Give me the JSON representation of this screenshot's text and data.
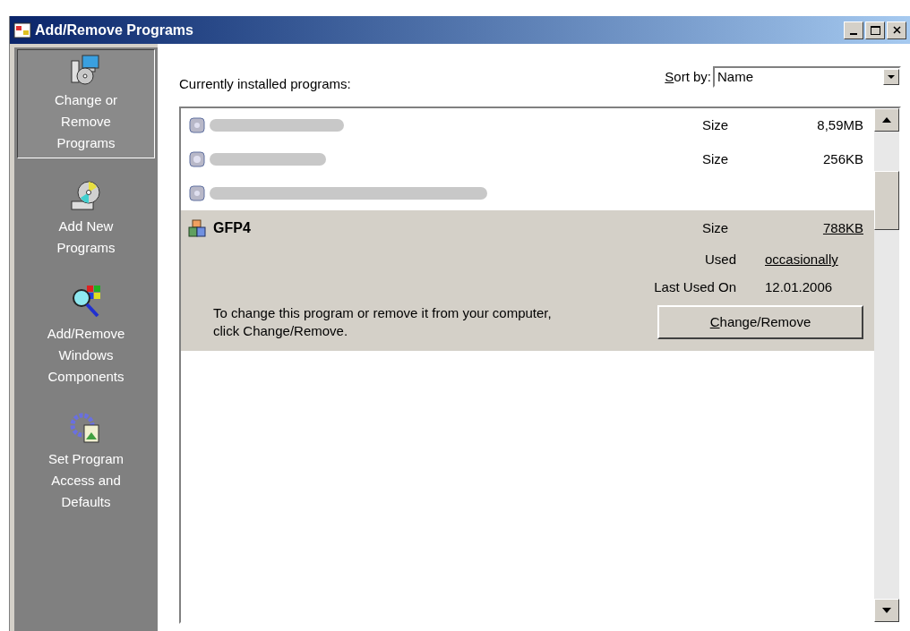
{
  "window": {
    "title": "Add/Remove Programs"
  },
  "sidebar": {
    "items": [
      {
        "label": "Change or Remove Programs",
        "selected": true,
        "kind": "change"
      },
      {
        "label": "Add New Programs",
        "selected": false,
        "kind": "add"
      },
      {
        "label": "Add/Remove Windows Components",
        "selected": false,
        "kind": "components"
      },
      {
        "label": "Set Program Access and Defaults",
        "selected": false,
        "kind": "defaults"
      }
    ]
  },
  "header": {
    "label": "Currently installed programs:",
    "sort_label": "Sort by:",
    "sort_value": "Name"
  },
  "programs": [
    {
      "kind": "redacted",
      "selected": false,
      "size_label": "Size",
      "size": "8,59MB"
    },
    {
      "kind": "redacted",
      "selected": false,
      "size_label": "Size",
      "size": "256KB"
    },
    {
      "kind": "redacted",
      "selected": false
    },
    {
      "kind": "named",
      "name": "GFP4",
      "selected": true,
      "size_label": "Size",
      "size": "788KB",
      "used_label": "Used",
      "used": "occasionally",
      "last_used_label": "Last Used On",
      "last_used": "12.01.2006",
      "hint": "To change this program or remove it from your computer, click Change/Remove.",
      "button": "Change/Remove"
    }
  ]
}
